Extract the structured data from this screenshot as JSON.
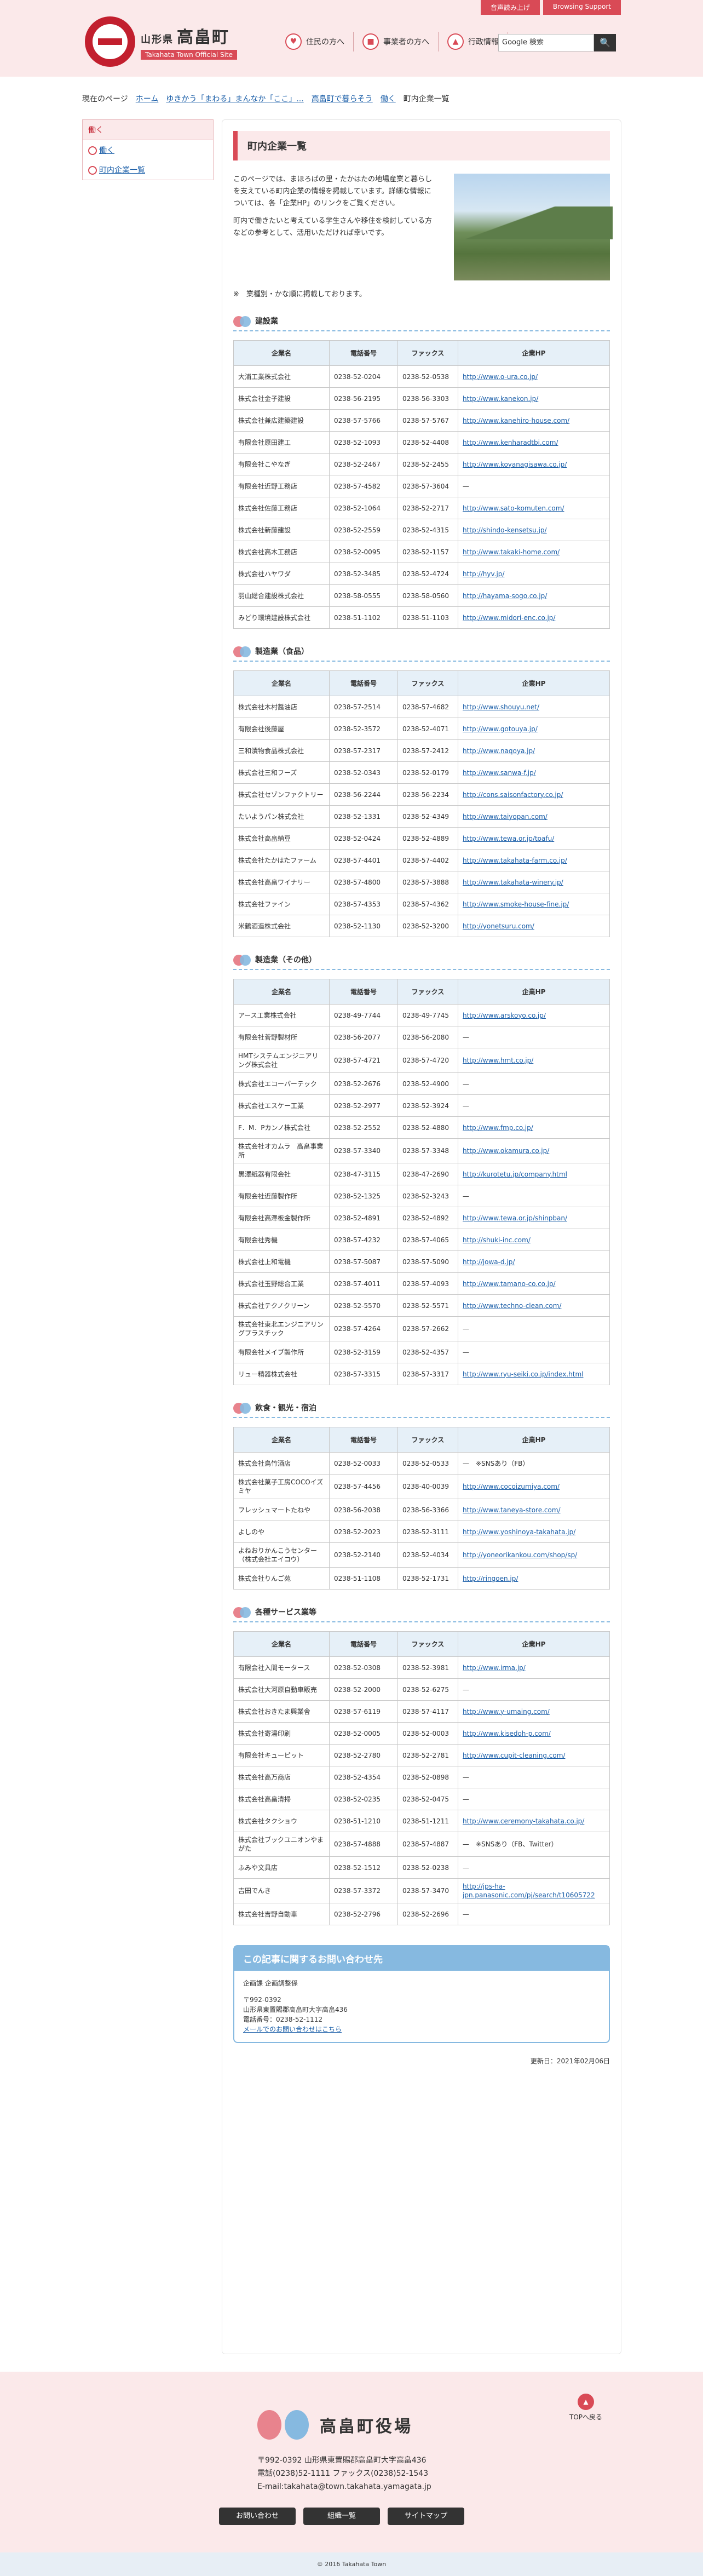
{
  "header": {
    "util": [
      "音声読み上げ",
      "Browsing Support"
    ],
    "pref": "山形県",
    "town": "高畠町",
    "sub": "Takahata Town Official Site",
    "nav": [
      "住民の方へ",
      "事業者の方へ",
      "行政情報"
    ],
    "search_placeholder": "Google 検索",
    "search_btn": "🔍"
  },
  "breadcrumb": {
    "label": "現在のページ",
    "items": [
      "ホーム",
      "ゆきかう「まわる」まんなか「ここ」...",
      "高畠町で暮らそう",
      "働く"
    ],
    "current": "町内企業一覧"
  },
  "sidebar": {
    "title": "働く",
    "items": [
      "働く",
      "町内企業一覧"
    ]
  },
  "page": {
    "title": "町内企業一覧",
    "intro": [
      "このページでは、まほろばの里・たかはたの地場産業と暮らしを支えている町内企業の情報を掲載しています。詳細な情報については、各「企業HP」のリンクをご覧ください。",
      "町内で働きたいと考えている学生さんや移住を検討している方などの参考として、活用いただければ幸いです。"
    ],
    "note": "※　業種別・かな順に掲載しております。"
  },
  "headers": [
    "企業名",
    "電話番号",
    "ファックス",
    "企業HP"
  ],
  "sections": [
    {
      "title": "建設業",
      "rows": [
        [
          "大浦工業株式会社",
          "0238-52-0204",
          "0238-52-0538",
          "http://www.o-ura.co.jp/"
        ],
        [
          "株式会社金子建設",
          "0238-56-2195",
          "0238-56-3303",
          "http://www.kanekon.jp/"
        ],
        [
          "株式会社兼広建築建設",
          "0238-57-5766",
          "0238-57-5767",
          "http://www.kanehiro-house.com/"
        ],
        [
          "有限会社原田建工",
          "0238-52-1093",
          "0238-52-4408",
          "http://www.kenharadtbi.com/"
        ],
        [
          "有限会社こやなぎ",
          "0238-52-2467",
          "0238-52-2455",
          "http://www.koyanagisawa.co.jp/"
        ],
        [
          "有限会社近野工務店",
          "0238-57-4582",
          "0238-57-3604",
          "—"
        ],
        [
          "株式会社佐藤工務店",
          "0238-52-1064",
          "0238-52-2717",
          "http://www.sato-komuten.com/"
        ],
        [
          "株式会社新藤建設",
          "0238-52-2559",
          "0238-52-4315",
          "http://shindo-kensetsu.jp/"
        ],
        [
          "株式会社高木工務店",
          "0238-52-0095",
          "0238-52-1157",
          "http://www.takaki-home.com/"
        ],
        [
          "株式会社ハヤワダ",
          "0238-52-3485",
          "0238-52-4724",
          "http://hyv.jp/"
        ],
        [
          "羽山総合建設株式会社",
          "0238-58-0555",
          "0238-58-0560",
          "http://hayama-sogo.co.jp/"
        ],
        [
          "みどり環境建設株式会社",
          "0238-51-1102",
          "0238-51-1103",
          "http://www.midori-enc.co.jp/"
        ]
      ]
    },
    {
      "title": "製造業（食品）",
      "rows": [
        [
          "株式会社木村醤油店",
          "0238-57-2514",
          "0238-57-4682",
          "http://www.shouyu.net/"
        ],
        [
          "有限会社後藤屋",
          "0238-52-3572",
          "0238-52-4071",
          "http://www.gotouya.jp/"
        ],
        [
          "三和漬物食品株式会社",
          "0238-57-2317",
          "0238-57-2412",
          "http://www.naqoya.jp/"
        ],
        [
          "株式会社三和フーズ",
          "0238-52-0343",
          "0238-52-0179",
          "http://www.sanwa-f.jp/"
        ],
        [
          "株式会社セゾンファクトリー",
          "0238-56-2244",
          "0238-56-2234",
          "http://cons.saisonfactory.co.jp/"
        ],
        [
          "たいようパン株式会社",
          "0238-52-1331",
          "0238-52-4349",
          "http://www.taiyopan.com/"
        ],
        [
          "株式会社高畠納豆",
          "0238-52-0424",
          "0238-52-4889",
          "http://www.tewa.or.jp/toafu/"
        ],
        [
          "株式会社たかはたファーム",
          "0238-57-4401",
          "0238-57-4402",
          "http://www.takahata-farm.co.jp/"
        ],
        [
          "株式会社高畠ワイナリー",
          "0238-57-4800",
          "0238-57-3888",
          "http://www.takahata-winery.jp/"
        ],
        [
          "株式会社ファイン",
          "0238-57-4353",
          "0238-57-4362",
          "http://www.smoke-house-fine.jp/"
        ],
        [
          "米鶴酒造株式会社",
          "0238-52-1130",
          "0238-52-3200",
          "http://yonetsuru.com/"
        ]
      ]
    },
    {
      "title": "製造業（その他）",
      "rows": [
        [
          "アース工業株式会社",
          "0238-49-7744",
          "0238-49-7745",
          "http://www.arskoyo.co.jp/"
        ],
        [
          "有限会社菅野製材所",
          "0238-56-2077",
          "0238-56-2080",
          "—"
        ],
        [
          "HMTシステムエンジニアリング株式会社",
          "0238-57-4721",
          "0238-57-4720",
          "http://www.hmt.co.jp/"
        ],
        [
          "株式会社エコーパーテック",
          "0238-52-2676",
          "0238-52-4900",
          "—"
        ],
        [
          "株式会社エスケー工業",
          "0238-52-2977",
          "0238-52-3924",
          "—"
        ],
        [
          "F．M．Pカンノ株式会社",
          "0238-52-2552",
          "0238-52-4880",
          "http://www.fmp.co.jp/"
        ],
        [
          "株式会社オカムラ　高畠事業所",
          "0238-57-3340",
          "0238-57-3348",
          "http://www.okamura.co.jp/"
        ],
        [
          "黒澤紙器有限会社",
          "0238-47-3115",
          "0238-47-2690",
          "http://kurotetu.jp/company.html"
        ],
        [
          "有限会社近藤製作所",
          "0238-52-1325",
          "0238-52-3243",
          "—"
        ],
        [
          "有限会社高澤板金製作所",
          "0238-52-4891",
          "0238-52-4892",
          "http://www.tewa.or.jp/shinpban/"
        ],
        [
          "有限会社秀機",
          "0238-57-4232",
          "0238-57-4065",
          "http://shuki-inc.com/"
        ],
        [
          "株式会社上和電機",
          "0238-57-5087",
          "0238-57-5090",
          "http://jowa-d.jp/"
        ],
        [
          "株式会社玉野総合工業",
          "0238-57-4011",
          "0238-57-4093",
          "http://www.tamano-co.co.jp/"
        ],
        [
          "株式会社テクノクリーン",
          "0238-52-5570",
          "0238-52-5571",
          "http://www.techno-clean.com/"
        ],
        [
          "株式会社東北エンジニアリングプラスチック",
          "0238-57-4264",
          "0238-57-2662",
          "—"
        ],
        [
          "有限会社メイブ製作所",
          "0238-52-3159",
          "0238-52-4357",
          "—"
        ],
        [
          "リュー精器株式会社",
          "0238-57-3315",
          "0238-57-3317",
          "http://www.ryu-seiki.co.jp/index.html"
        ]
      ]
    },
    {
      "title": "飲食・観光・宿泊",
      "rows": [
        [
          "株式会社鳥竹酒店",
          "0238-52-0033",
          "0238-52-0533",
          "—　※SNSあり（FB）"
        ],
        [
          "株式会社菓子工房COCOイズミヤ",
          "0238-57-4456",
          "0238-40-0039",
          "http://www.cocoizumiya.com/"
        ],
        [
          "フレッシュマートたねや",
          "0238-56-2038",
          "0238-56-3366",
          "http://www.taneya-store.com/"
        ],
        [
          "よしのや",
          "0238-52-2023",
          "0238-52-3111",
          "http://www.yoshinoya-takahata.jp/"
        ],
        [
          "よねおりかんこうセンター（株式会社エイコウ）",
          "0238-52-2140",
          "0238-52-4034",
          "http://yoneorikankou.com/shop/sp/"
        ],
        [
          "株式会社りんご苑",
          "0238-51-1108",
          "0238-52-1731",
          "http://ringoen.jp/"
        ]
      ]
    },
    {
      "title": "各種サービス業等",
      "rows": [
        [
          "有限会社入間モータース",
          "0238-52-0308",
          "0238-52-3981",
          "http://www.irma.jp/"
        ],
        [
          "株式会社大河原自動車販売",
          "0238-52-2000",
          "0238-52-6275",
          "—"
        ],
        [
          "株式会社おきたま興業舎",
          "0238-57-6119",
          "0238-57-4117",
          "http://www.y-umaing.com/"
        ],
        [
          "株式会社寄湯印刷",
          "0238-52-0005",
          "0238-52-0003",
          "http://www.kisedoh-p.com/"
        ],
        [
          "有限会社キューピット",
          "0238-52-2780",
          "0238-52-2781",
          "http://www.cupit-cleaning.com/"
        ],
        [
          "株式会社高万商店",
          "0238-52-4354",
          "0238-52-0898",
          "—"
        ],
        [
          "株式会社高畠清掃",
          "0238-52-0235",
          "0238-52-0475",
          "—"
        ],
        [
          "株式会社タクショウ",
          "0238-51-1210",
          "0238-51-1211",
          "http://www.ceremony-takahata.co.jp/"
        ],
        [
          "株式会社ブックユニオンやまがた",
          "0238-57-4888",
          "0238-57-4887",
          "—　※SNSあり（FB、Twitter）"
        ],
        [
          "ふみや文具店",
          "0238-52-1512",
          "0238-52-0238",
          "—"
        ],
        [
          "吉田でんき",
          "0238-57-3372",
          "0238-57-3470",
          "http://jps-ha-jpn.panasonic.com/pj/search/t10605722"
        ],
        [
          "株式会社吉野自動車",
          "0238-52-2796",
          "0238-52-2696",
          "—"
        ]
      ]
    }
  ],
  "contact": {
    "title": "この記事に関するお問い合わせ先",
    "dept": "企画課 企画調整係",
    "zip": "〒992-0392",
    "addr": "山形県東置賜郡高畠町大字高畠436",
    "tel": "電話番号：0238-52-1112",
    "link": "メールでのお問い合わせはこちら"
  },
  "updated": "更新日：2021年02月06日",
  "footer": {
    "name": "高畠町役場",
    "addr1": "〒992-0392 山形県東置賜郡高畠町大字高畠436",
    "addr2": "電話(0238)52-1111 ファックス(0238)52-1543",
    "addr3": "E-mail:takahata@town.takahata.yamagata.jp",
    "buttons": [
      "お問い合わせ",
      "組織一覧",
      "サイトマップ"
    ],
    "totop": "TOPへ戻る",
    "copy": "© 2016 Takahata Town"
  }
}
